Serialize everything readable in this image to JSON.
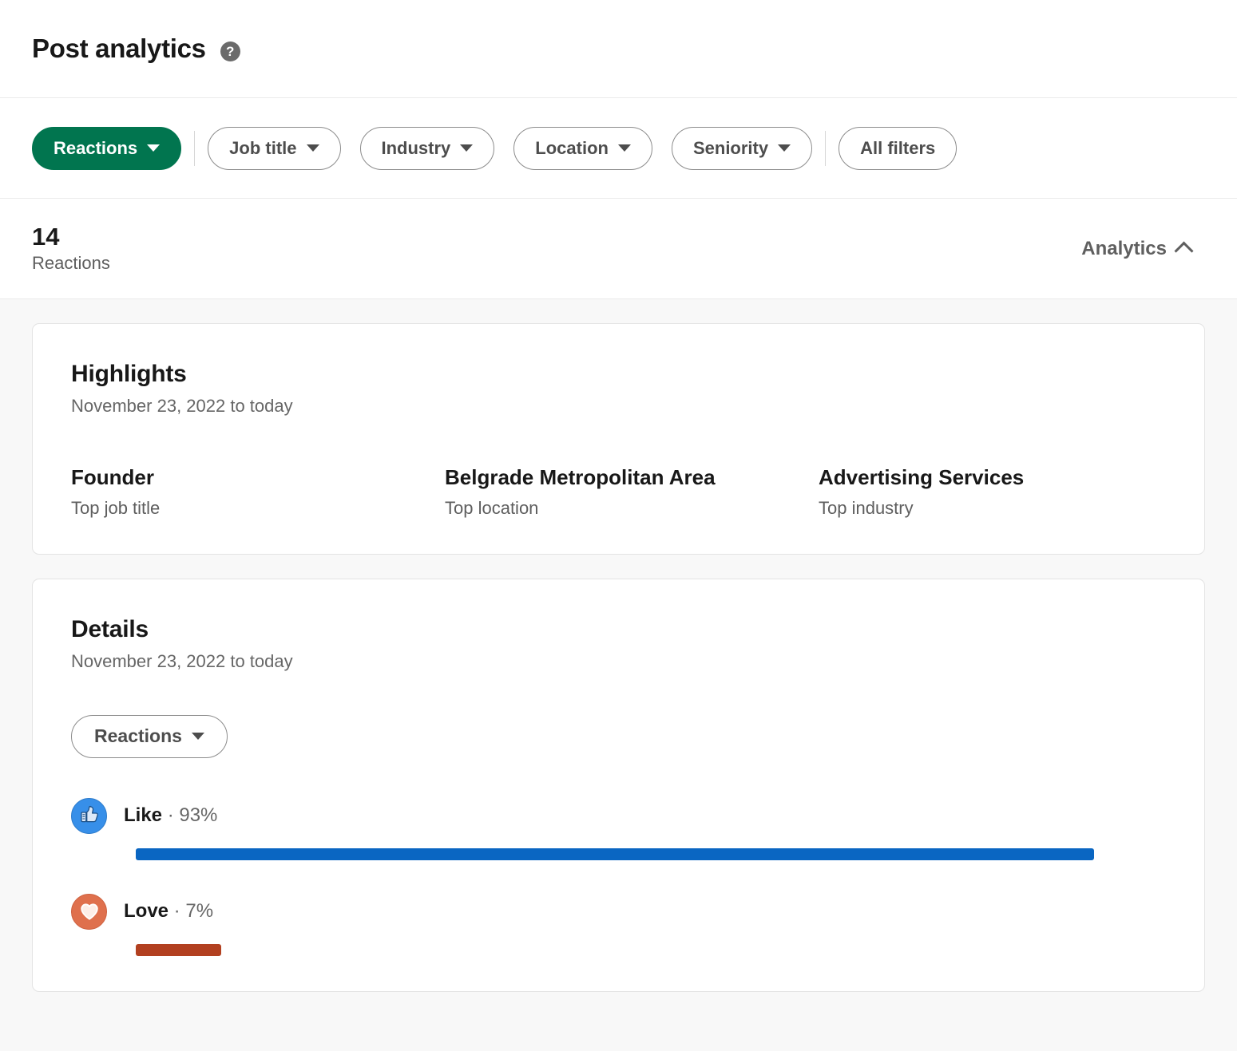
{
  "header": {
    "title": "Post analytics",
    "help_icon": "help-question-icon"
  },
  "filters": {
    "primary": {
      "label": "Reactions",
      "selected": true,
      "color": "#01754f"
    },
    "items": [
      {
        "label": "Job title",
        "has_caret": true
      },
      {
        "label": "Industry",
        "has_caret": true
      },
      {
        "label": "Location",
        "has_caret": true
      },
      {
        "label": "Seniority",
        "has_caret": true
      }
    ],
    "all_filters": {
      "label": "All filters",
      "has_caret": false
    }
  },
  "summary": {
    "value": "14",
    "label": "Reactions",
    "analytics_toggle": "Analytics",
    "analytics_state": "expanded"
  },
  "highlights": {
    "title": "Highlights",
    "date_range": "November 23, 2022 to today",
    "items": [
      {
        "value": "Founder",
        "label": "Top job title"
      },
      {
        "value": "Belgrade Metropolitan Area",
        "label": "Top location"
      },
      {
        "value": "Advertising Services",
        "label": "Top industry"
      }
    ]
  },
  "details": {
    "title": "Details",
    "date_range": "November 23, 2022 to today",
    "dropdown": {
      "label": "Reactions",
      "has_caret": true
    }
  },
  "chart_data": {
    "type": "bar",
    "title": "Details",
    "subtitle": "November 23, 2022 to today",
    "orientation": "horizontal",
    "categories": [
      "Like",
      "Love"
    ],
    "values": [
      93,
      7
    ],
    "value_suffix": "%",
    "labels": [
      "Like · 93%",
      "Love · 7%"
    ],
    "colors": [
      "#0a66c2",
      "#b24020"
    ],
    "icon_colors": [
      "#378fe9",
      "#df704d"
    ],
    "icons": [
      "thumbs-up-icon",
      "heart-icon"
    ],
    "xlabel": "",
    "ylabel": "",
    "xlim": [
      0,
      100
    ],
    "grid": false,
    "legend": "none"
  },
  "colors": {
    "brand_green": "#01754f",
    "like_blue": "#0a66c2",
    "love_red": "#b24020",
    "page_background": "#f8f8f8",
    "card_background": "#ffffff"
  }
}
